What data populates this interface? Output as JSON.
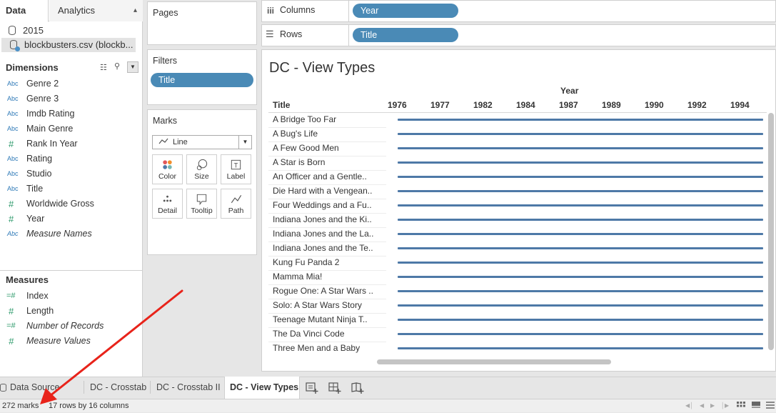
{
  "data_pane": {
    "tabs": {
      "data": "Data",
      "analytics": "Analytics"
    },
    "datasources": [
      {
        "name": "2015",
        "selected": false
      },
      {
        "name": "blockbusters.csv (blockb...",
        "selected": true
      }
    ],
    "dimensions_label": "Dimensions",
    "dimensions": [
      {
        "type": "Abc",
        "name": "Genre 2",
        "italic": false
      },
      {
        "type": "Abc",
        "name": "Genre 3",
        "italic": false
      },
      {
        "type": "Abc",
        "name": "Imdb Rating",
        "italic": false
      },
      {
        "type": "Abc",
        "name": "Main Genre",
        "italic": false
      },
      {
        "type": "#",
        "name": "Rank In Year",
        "italic": false
      },
      {
        "type": "Abc",
        "name": "Rating",
        "italic": false
      },
      {
        "type": "Abc",
        "name": "Studio",
        "italic": false
      },
      {
        "type": "Abc",
        "name": "Title",
        "italic": false
      },
      {
        "type": "#",
        "name": "Worldwide Gross",
        "italic": false
      },
      {
        "type": "#",
        "name": "Year",
        "italic": false
      },
      {
        "type": "Abc",
        "name": "Measure Names",
        "italic": true
      }
    ],
    "measures_label": "Measures",
    "measures": [
      {
        "type": "=#",
        "name": "Index",
        "italic": false
      },
      {
        "type": "#",
        "name": "Length",
        "italic": false
      },
      {
        "type": "=#",
        "name": "Number of Records",
        "italic": true
      },
      {
        "type": "#",
        "name": "Measure Values",
        "italic": true
      }
    ]
  },
  "pages": {
    "label": "Pages"
  },
  "filters": {
    "label": "Filters",
    "pill": "Title"
  },
  "marks": {
    "label": "Marks",
    "type": "Line",
    "buttons": [
      "Color",
      "Size",
      "Label",
      "Detail",
      "Tooltip",
      "Path"
    ]
  },
  "shelves": {
    "columns_label": "Columns",
    "columns_pill": "Year",
    "rows_label": "Rows",
    "rows_pill": "Title"
  },
  "view": {
    "title": "DC - View Types",
    "column_group_header": "Year",
    "row_header": "Title",
    "years": [
      "1976",
      "1977",
      "1982",
      "1984",
      "1987",
      "1989",
      "1990",
      "1992",
      "1994"
    ],
    "rows": [
      "A Bridge Too Far",
      "A Bug's Life",
      "A Few Good Men",
      "A Star is Born",
      "An Officer and a Gentle..",
      "Die Hard with a Vengean..",
      "Four Weddings and a Fu..",
      "Indiana Jones and the Ki..",
      "Indiana Jones and the La..",
      "Indiana Jones and the Te..",
      "Kung Fu Panda 2",
      "Mamma Mia!",
      "Rogue One: A Star Wars ..",
      "Solo: A Star Wars Story",
      "Teenage Mutant Ninja T..",
      "The Da Vinci Code",
      "Three Men and a Baby"
    ],
    "line_color": "#4e79a7"
  },
  "sheet_tabs": [
    {
      "label": "Data Source",
      "active": false
    },
    {
      "label": "DC - Crosstab",
      "active": false
    },
    {
      "label": "DC - Crosstab II",
      "active": false
    },
    {
      "label": "DC - View Types",
      "active": true
    }
  ],
  "status": {
    "marks": "272 marks",
    "dims": "17 rows by 16 columns"
  },
  "colors": {
    "pill": "#4a8ab6",
    "annotation_arrow": "#e8231a"
  }
}
